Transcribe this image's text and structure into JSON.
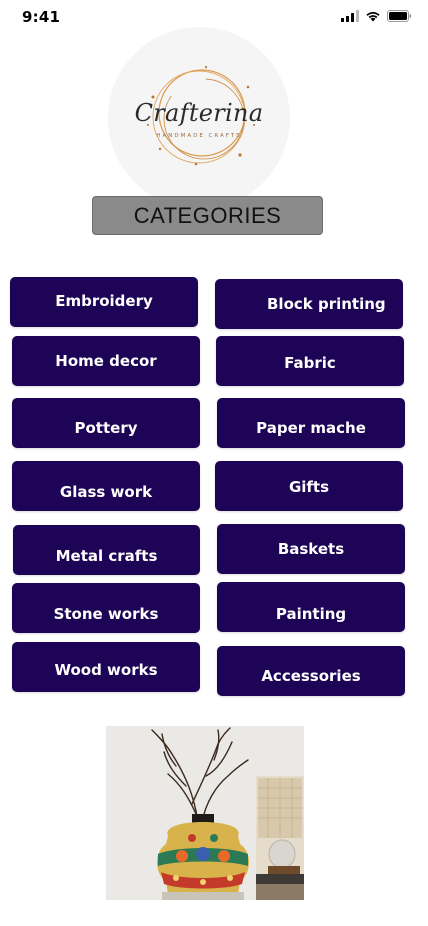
{
  "status_bar": {
    "time": "9:41",
    "icons": [
      "cellular-signal-icon",
      "wifi-icon",
      "battery-icon"
    ]
  },
  "logo": {
    "brand": "Crafterina",
    "tagline": "HANDMADE CRAFTS"
  },
  "categories_header": "CATEGORIES",
  "categories": [
    "Embroidery",
    "Block printing",
    "Home decor",
    "Fabric",
    "Pottery",
    "Paper mache",
    "Glass work",
    "Gifts",
    "Metal crafts",
    "Baskets",
    "Stone works",
    "Painting",
    "Wood works",
    "Accessories"
  ],
  "colors": {
    "button_bg": "#1d0456",
    "button_text": "#ffffff",
    "header_bg": "#8a8a8a",
    "logo_ring": "#d99a4e"
  },
  "images": {
    "bottom_photo": "painted-vase-with-branches"
  }
}
